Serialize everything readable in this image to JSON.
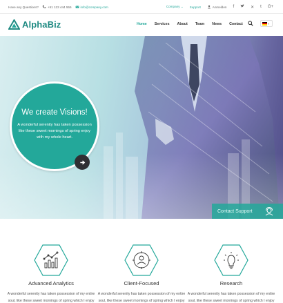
{
  "topbar": {
    "question": "Have any Questions?",
    "phone": "+51 123 444 555",
    "email": "info@company.com",
    "company": "Company",
    "support": "Support",
    "login": "Anmelden",
    "social_icons": [
      "facebook-icon",
      "twitter-icon",
      "xing-icon",
      "tumblr-icon",
      "google-plus-icon"
    ]
  },
  "brand": {
    "name": "AlphaBiz",
    "accent": "#23a89a"
  },
  "nav": {
    "items": [
      {
        "label": "Home",
        "active": true
      },
      {
        "label": "Services",
        "active": false
      },
      {
        "label": "About",
        "active": false
      },
      {
        "label": "Team",
        "active": false
      },
      {
        "label": "News",
        "active": false
      },
      {
        "label": "Contact",
        "active": false
      }
    ]
  },
  "hero": {
    "headline": "We create Visions!",
    "text": "A wonderful serenity has taken possession like these sweet mornings of spring enjoy with my whole heart."
  },
  "contact_support": {
    "label": "Contact Support"
  },
  "features": [
    {
      "title": "Advanced Analytics",
      "text": "A wonderful serenity has taken possession of my entire soul, like these sweet mornings of spring which I enjoy",
      "icon": "analytics-chart-icon"
    },
    {
      "title": "Client-Focused",
      "text": "A wonderful serenity has taken possession of my entire soul, like these sweet mornings of spring which I enjoy",
      "icon": "client-focus-icon"
    },
    {
      "title": "Research",
      "text": "A wonderful serenity has taken possession of my entire soul, like these sweet mornings of spring which I enjoy",
      "icon": "lightbulb-icon"
    }
  ]
}
